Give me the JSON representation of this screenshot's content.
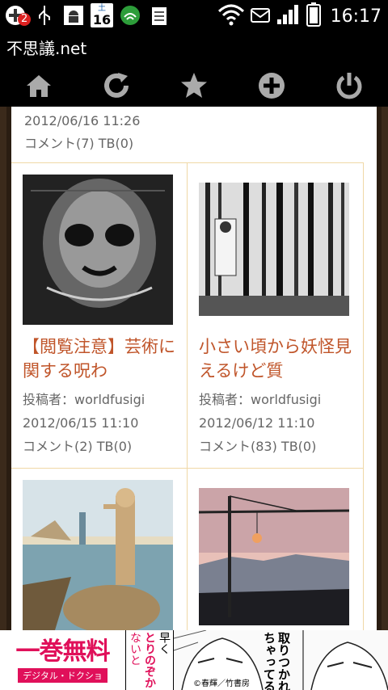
{
  "status_bar": {
    "notification_count": "2",
    "calendar_label": "土",
    "calendar_day": "16",
    "time": "16:17"
  },
  "title": "不思議.net",
  "toolbar": {
    "icons": [
      "home-icon",
      "reload-icon",
      "star-icon",
      "add-icon",
      "power-icon"
    ]
  },
  "previous_item": {
    "date": "2012/06/16 11:26",
    "stats": "コメント(7)  TB(0)"
  },
  "cards": [
    {
      "title": "【閲覧注意】芸術に関する呪わ",
      "author": "投稿者：worldfusigi",
      "date": "2012/06/15 11:10",
      "stats": "コメント(2)  TB(0)"
    },
    {
      "title": "小さい頃から妖怪見えるけど質",
      "author": "投稿者：worldfusigi",
      "date": "2012/06/12 11:10",
      "stats": "コメント(83)  TB(0)"
    },
    {
      "title": "",
      "author": "",
      "date": "",
      "stats": ""
    },
    {
      "title": "",
      "author": "",
      "date": "",
      "stats": ""
    }
  ],
  "ad": {
    "main": "一巻無料",
    "sub": "デジタル・ドクショ",
    "mid_text_1": "早く",
    "mid_text_2": "とりのぞか",
    "mid_text_3": "ないと",
    "right_text_1": "取りつかれ",
    "right_text_2": "ちゃってる",
    "credit": "©春輝／竹書房"
  },
  "colors": {
    "accent": "#c0552a",
    "border": "#f0d8a6",
    "ad_pink": "#e0105a"
  }
}
